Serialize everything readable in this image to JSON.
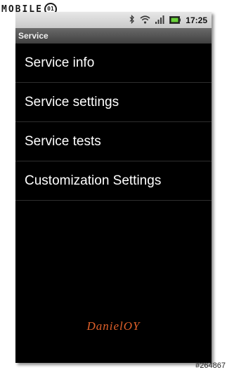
{
  "watermark": {
    "brand": "MOBILE",
    "photo_id": "#264867"
  },
  "status_bar": {
    "icons": [
      "bluetooth-icon",
      "wifi-icon",
      "signal-icon",
      "battery-icon"
    ],
    "time": "17:25"
  },
  "title_bar": {
    "title": "Service"
  },
  "menu": {
    "items": [
      {
        "label": "Service info"
      },
      {
        "label": "Service settings"
      },
      {
        "label": "Service tests"
      },
      {
        "label": "Customization Settings"
      }
    ]
  },
  "signature": {
    "text": "DanielOY"
  },
  "colors": {
    "background": "#000000",
    "menu_text": "#ffffff",
    "divider": "#2e2e2e",
    "signature": "#e0602a",
    "battery_fill": "#6ad33a"
  }
}
